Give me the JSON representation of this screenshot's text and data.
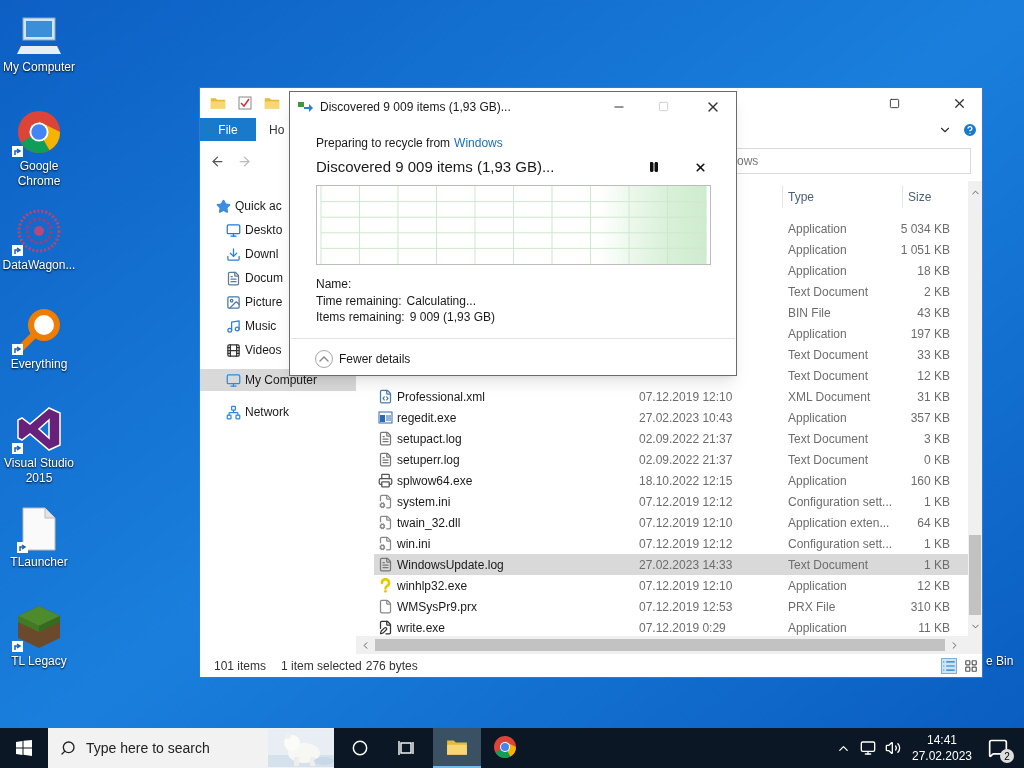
{
  "desktop_icons": [
    {
      "label": "My Computer",
      "kind": "computer",
      "shortcut": false
    },
    {
      "label": "Google Chrome",
      "kind": "chrome",
      "shortcut": true
    },
    {
      "label": "DataWagon...",
      "kind": "mandala",
      "shortcut": true
    },
    {
      "label": "Everything",
      "kind": "magnifier",
      "shortcut": true
    },
    {
      "label": "Visual Studio 2015",
      "kind": "vs",
      "shortcut": true
    },
    {
      "label": "TLauncher",
      "kind": "blank",
      "shortcut": true
    },
    {
      "label": "TL Legacy",
      "kind": "block",
      "shortcut": true
    }
  ],
  "recycle_bin": {
    "label": "e Bin"
  },
  "explorer": {
    "ribbon_tabs": [
      {
        "label": "File",
        "kind": "file_menu"
      },
      {
        "label": "Ho",
        "kind": "tab"
      }
    ],
    "search": {
      "placeholder": "ows"
    },
    "nav": [
      {
        "label": "Quick ac",
        "kind": "star",
        "selected": false
      },
      {
        "label": "Deskto",
        "kind": "desktop",
        "selected": false
      },
      {
        "label": "Downl",
        "kind": "download",
        "selected": false
      },
      {
        "label": "Docum",
        "kind": "document",
        "selected": false
      },
      {
        "label": "Picture",
        "kind": "pictures",
        "selected": false
      },
      {
        "label": "Music",
        "kind": "music",
        "selected": false
      },
      {
        "label": "Videos",
        "kind": "videos",
        "selected": false
      },
      {
        "label": "My Computer",
        "kind": "computer",
        "selected": true
      },
      {
        "label": "Network",
        "kind": "network",
        "selected": false
      }
    ],
    "type_header": "Type",
    "size_header": "Size",
    "rows": [
      {
        "type": "Application",
        "size": "5 034 KB",
        "selected": false
      },
      {
        "type": "Application",
        "size": "1 051 KB",
        "selected": false
      },
      {
        "type": "Application",
        "size": "18 KB",
        "selected": false
      },
      {
        "type": "Text Document",
        "size": "2 KB",
        "selected": false
      },
      {
        "type": "BIN File",
        "size": "43 KB",
        "selected": false
      },
      {
        "type": "Application",
        "size": "197 KB",
        "selected": false
      },
      {
        "type": "Text Document",
        "size": "33 KB",
        "selected": false
      },
      {
        "type": "Text Document",
        "size": "12 KB",
        "selected": false
      },
      {
        "name": "Professional.xml",
        "kind": "xml",
        "date": "07.12.2019 12:10",
        "type": "XML Document",
        "size": "31 KB",
        "selected": false
      },
      {
        "name": "regedit.exe",
        "kind": "regedit",
        "date": "27.02.2023 10:43",
        "type": "Application",
        "size": "357 KB",
        "selected": false
      },
      {
        "name": "setupact.log",
        "kind": "text",
        "date": "02.09.2022 21:37",
        "type": "Text Document",
        "size": "3 KB",
        "selected": false
      },
      {
        "name": "setuperr.log",
        "kind": "text",
        "date": "02.09.2022 21:37",
        "type": "Text Document",
        "size": "0 KB",
        "selected": false
      },
      {
        "name": "splwow64.exe",
        "kind": "printer",
        "date": "18.10.2022 12:15",
        "type": "Application",
        "size": "160 KB",
        "selected": false
      },
      {
        "name": "system.ini",
        "kind": "config",
        "date": "07.12.2019 12:12",
        "type": "Configuration sett...",
        "size": "1 KB",
        "selected": false
      },
      {
        "name": "twain_32.dll",
        "kind": "config",
        "date": "07.12.2019 12:10",
        "type": "Application exten...",
        "size": "64 KB",
        "selected": false
      },
      {
        "name": "win.ini",
        "kind": "config",
        "date": "07.12.2019 12:12",
        "type": "Configuration sett...",
        "size": "1 KB",
        "selected": false
      },
      {
        "name": "WindowsUpdate.log",
        "kind": "text",
        "date": "27.02.2023 14:33",
        "type": "Text Document",
        "size": "1 KB",
        "selected": true
      },
      {
        "name": "winhlp32.exe",
        "kind": "help",
        "date": "07.12.2019 12:10",
        "type": "Application",
        "size": "12 KB",
        "selected": false
      },
      {
        "name": "WMSysPr9.prx",
        "kind": "blank",
        "date": "07.12.2019 12:53",
        "type": "PRX File",
        "size": "310 KB",
        "selected": false
      },
      {
        "name": "write.exe",
        "kind": "write",
        "date": "07.12.2019 0:29",
        "type": "Application",
        "size": "11 KB",
        "selected": false
      }
    ],
    "status": {
      "count": "101 items",
      "selection": "1 item selected",
      "size": "276 bytes"
    }
  },
  "dialog": {
    "title": "Discovered 9 009 items (1,93 GB)...",
    "from_text": "Preparing to recycle from",
    "from_link": "Windows",
    "heading": "Discovered 9 009 items (1,93 GB)...",
    "details": [
      {
        "label": "Name:"
      },
      {
        "label": "Time remaining:",
        "value": "Calculating..."
      },
      {
        "label": "Items remaining:",
        "value": "9 009 (1,93 GB)"
      }
    ],
    "toggle": "Fewer details"
  },
  "taskbar": {
    "search_placeholder": "Type here to search",
    "apps": [
      {
        "kind": "explorer",
        "active": true
      },
      {
        "kind": "chrome",
        "active": false
      }
    ],
    "time": "14:41",
    "date": "27.02.2023",
    "notifications": "2"
  }
}
